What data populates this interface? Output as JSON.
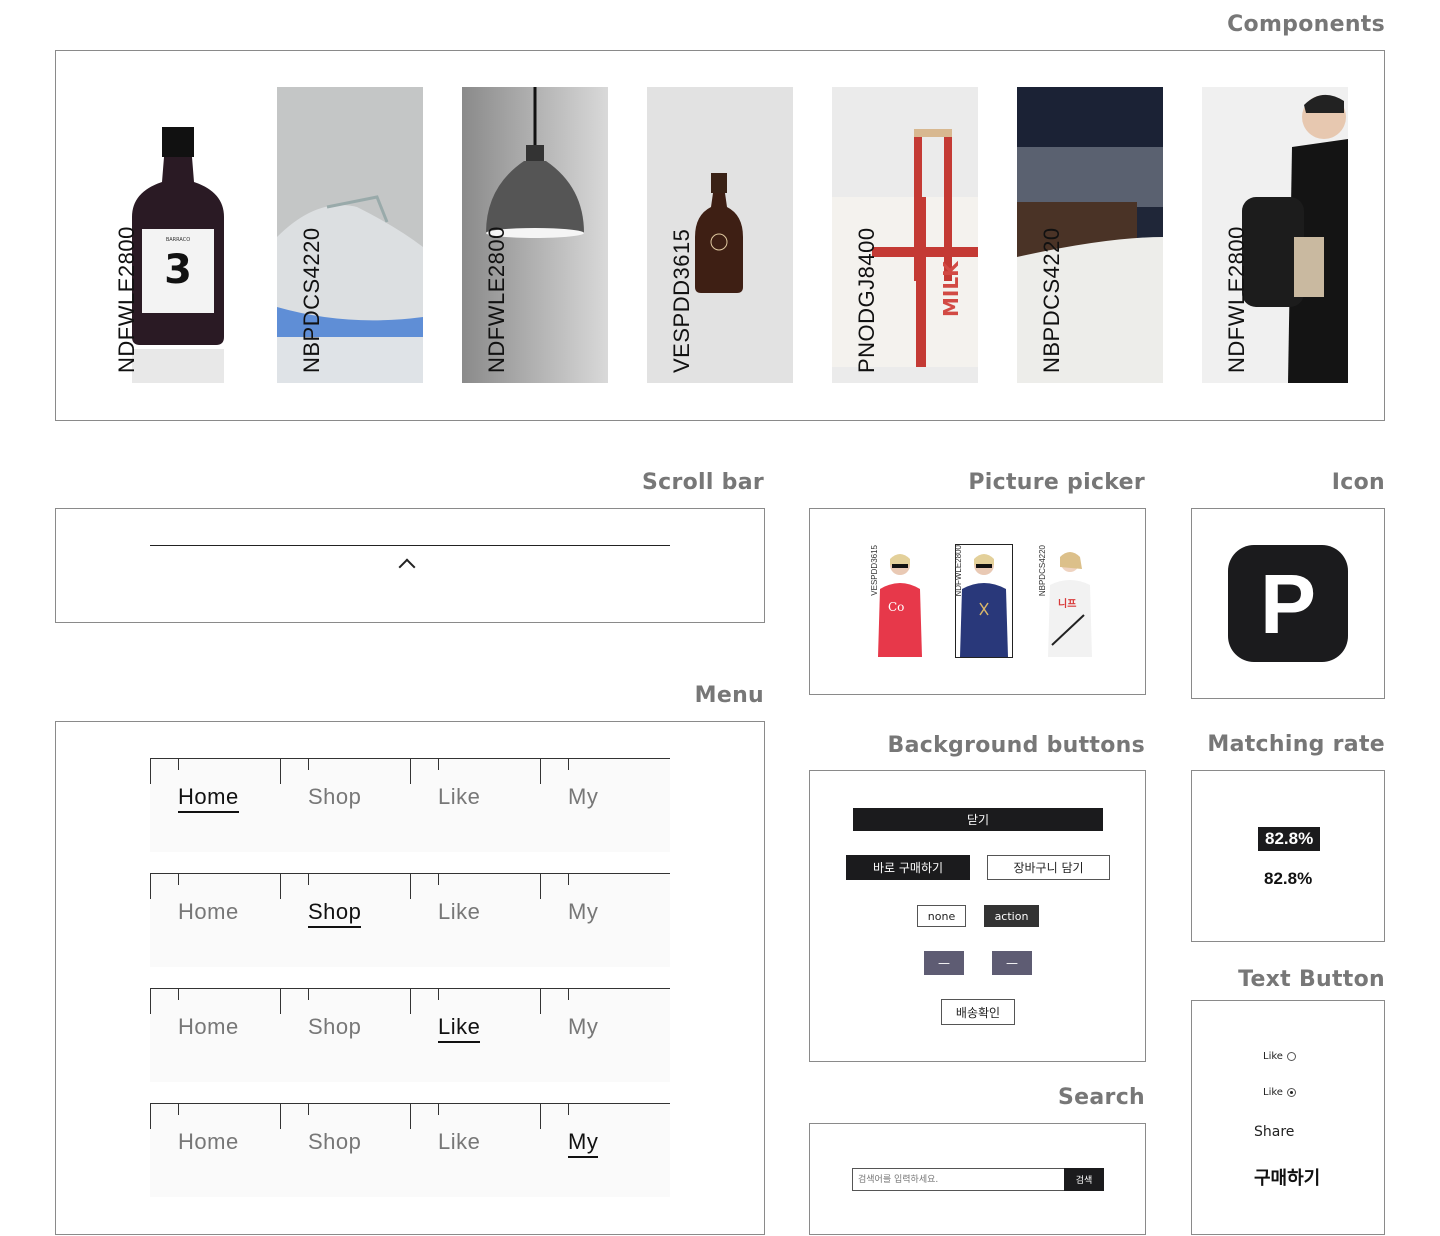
{
  "sections": {
    "components": "Components",
    "scrollbar": "Scroll bar",
    "picture_picker": "Picture picker",
    "icon": "Icon",
    "menu": "Menu",
    "background_buttons": "Background buttons",
    "matching_rate": "Matching rate",
    "search": "Search",
    "text_button": "Text Button"
  },
  "components": {
    "products": [
      {
        "code": "NDFWLE2800",
        "image": "dark-liquor-bottle-3"
      },
      {
        "code": "NBPDCS4220",
        "image": "grey-sneaker"
      },
      {
        "code": "NDFWLE2800",
        "image": "pendant-lamp"
      },
      {
        "code": "VESPDD3615",
        "image": "swing-top-bottle"
      },
      {
        "code": "PNODGJ8400",
        "image": "milk-carrier"
      },
      {
        "code": "NBPDCS4220",
        "image": "rolled-jeans-sneaker"
      },
      {
        "code": "NDFWLE2800",
        "image": "man-with-backpack"
      }
    ]
  },
  "menu": {
    "items": [
      "Home",
      "Shop",
      "Like",
      "My"
    ],
    "rows": [
      {
        "active": "Home"
      },
      {
        "active": "Shop"
      },
      {
        "active": "Like"
      },
      {
        "active": "My"
      }
    ]
  },
  "picture_picker": {
    "items": [
      {
        "code": "VESPDD3615",
        "image": "red-shirt-model",
        "selected": false
      },
      {
        "code": "NDFWLE2800",
        "image": "navy-shirt-model",
        "selected": true
      },
      {
        "code": "NBPDCS4220",
        "image": "white-shirt-model",
        "selected": false
      }
    ]
  },
  "icon": {
    "letter": "P",
    "name": "p-app-icon"
  },
  "background_buttons": {
    "close": "닫기",
    "buy_now": "바로 구매하기",
    "add_cart": "장바구니 담기",
    "none": "none",
    "action": "action",
    "minus1": "—",
    "minus2": "—",
    "delivery": "배송확인"
  },
  "matching_rate": {
    "highlighted": "82.8%",
    "plain": "82.8%"
  },
  "search": {
    "placeholder": "검색어를 입력하세요.",
    "button": "검색"
  },
  "text_button": {
    "like_off": "Like",
    "like_on": "Like",
    "share": "Share",
    "buy": "구매하기"
  },
  "colors": {
    "dark": "#1b1b1d",
    "purple": "#5e5c73",
    "title_grey": "#777777"
  }
}
